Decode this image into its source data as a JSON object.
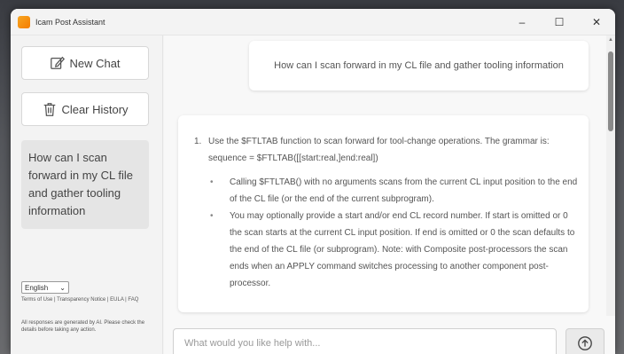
{
  "window": {
    "title": "Icam Post Assistant",
    "controls": {
      "minimize": "–",
      "maximize": "☐",
      "close": "✕"
    }
  },
  "sidebar": {
    "new_chat_label": "New Chat",
    "clear_history_label": "Clear History",
    "history": [
      "How can I scan forward in my CL file and gather tooling information"
    ],
    "language": "English",
    "footer_links": "Terms of Use | Transparency Notice | EULA | FAQ",
    "footer_note": "All responses are generated by AI. Please check the details before taking any action."
  },
  "chat": {
    "user_message": "How can I scan forward in my CL file and gather tooling information",
    "assistant": {
      "step_number": "1.",
      "step_text": "Use the $FTLTAB function to scan forward for tool-change operations. The grammar is: sequence = $FTLTAB([[start:real,]end:real])",
      "bullets": [
        "Calling $FTLTAB() with no arguments scans from the current CL input position to the end of the CL file (or the end of the current subprogram).",
        "You may optionally provide a start and/or end CL record number. If start is omitted or 0 the scan starts at the current CL input position. If end is omitted or 0 the scan defaults to the end of the CL file (or subprogram). Note: with Composite post-processors the scan ends when an APPLY command switches processing to another component post-processor."
      ]
    }
  },
  "input": {
    "placeholder": "What would you like help with..."
  },
  "icons": {
    "new_chat": "edit-icon",
    "clear_history": "trash-icon",
    "send": "arrow-up-icon",
    "app": "app-icon"
  }
}
